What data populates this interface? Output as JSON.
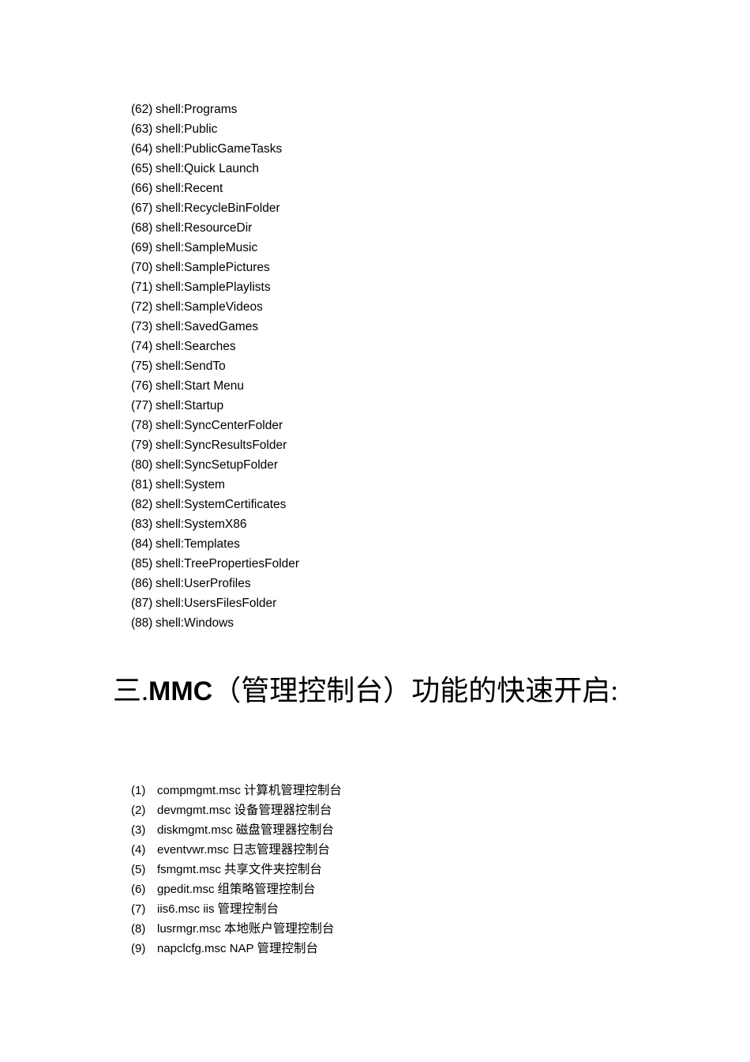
{
  "document": {
    "page_background": "#ffffff",
    "text_color": "#000000"
  },
  "shell_list": {
    "items": [
      {
        "number": "(62)",
        "text": "shell:Programs"
      },
      {
        "number": "(63)",
        "text": "shell:Public"
      },
      {
        "number": "(64)",
        "text": "shell:PublicGameTasks"
      },
      {
        "number": "(65)",
        "text": "shell:Quick Launch"
      },
      {
        "number": "(66)",
        "text": "shell:Recent"
      },
      {
        "number": "(67)",
        "text": "shell:RecycleBinFolder"
      },
      {
        "number": "(68)",
        "text": "shell:ResourceDir"
      },
      {
        "number": "(69)",
        "text": "shell:SampleMusic"
      },
      {
        "number": "(70)",
        "text": "shell:SamplePictures"
      },
      {
        "number": "(71)",
        "text": "shell:SamplePlaylists"
      },
      {
        "number": "(72)",
        "text": "shell:SampleVideos"
      },
      {
        "number": "(73)",
        "text": "shell:SavedGames"
      },
      {
        "number": "(74)",
        "text": "shell:Searches"
      },
      {
        "number": "(75)",
        "text": "shell:SendTo"
      },
      {
        "number": "(76)",
        "text": "shell:Start Menu"
      },
      {
        "number": "(77)",
        "text": "shell:Startup"
      },
      {
        "number": "(78)",
        "text": "shell:SyncCenterFolder"
      },
      {
        "number": "(79)",
        "text": "shell:SyncResultsFolder"
      },
      {
        "number": "(80)",
        "text": "shell:SyncSetupFolder"
      },
      {
        "number": "(81)",
        "text": "shell:System"
      },
      {
        "number": "(82)",
        "text": "shell:SystemCertificates"
      },
      {
        "number": "(83)",
        "text": "shell:SystemX86"
      },
      {
        "number": "(84)",
        "text": "shell:Templates"
      },
      {
        "number": "(85)",
        "text": "shell:TreePropertiesFolder"
      },
      {
        "number": "(86)",
        "text": "shell:UserProfiles"
      },
      {
        "number": "(87)",
        "text": "shell:UsersFilesFolder"
      },
      {
        "number": "(88)",
        "text": "shell:Windows"
      }
    ]
  },
  "section_heading": {
    "prefix": "三.",
    "latin": "MMC",
    "suffix": "（管理控制台）功能的快速开启:"
  },
  "msc_list": {
    "items": [
      {
        "number": "(1)",
        "command": "compmgmt.msc",
        "description": "计算机管理控制台"
      },
      {
        "number": "(2)",
        "command": "devmgmt.msc",
        "description": "设备管理器控制台"
      },
      {
        "number": "(3)",
        "command": "diskmgmt.msc",
        "description": "磁盘管理器控制台"
      },
      {
        "number": "(4)",
        "command": "eventvwr.msc",
        "description": "日志管理器控制台"
      },
      {
        "number": "(5)",
        "command": "fsmgmt.msc",
        "description": "共享文件夹控制台"
      },
      {
        "number": "(6)",
        "command": "gpedit.msc",
        "description": "组策略管理控制台"
      },
      {
        "number": "(7)",
        "command": "iis6.msc iis",
        "description": "管理控制台"
      },
      {
        "number": "(8)",
        "command": "lusrmgr.msc",
        "description": "本地账户管理控制台"
      },
      {
        "number": "(9)",
        "command": "napclcfg.msc NAP",
        "description": "管理控制台"
      }
    ]
  }
}
